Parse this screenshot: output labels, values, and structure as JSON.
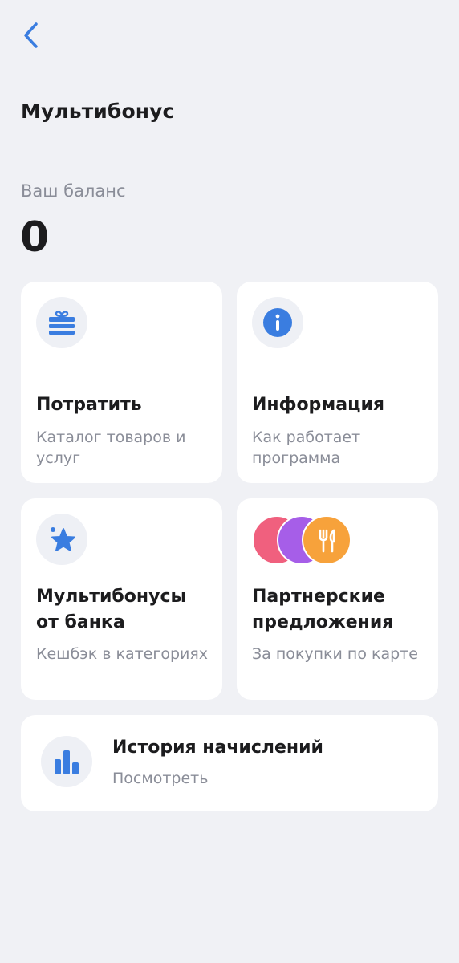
{
  "header": {
    "title": "Мультибонус"
  },
  "balance": {
    "label": "Ваш баланс",
    "value": "0"
  },
  "tiles": {
    "spend": {
      "title": "Потратить",
      "subtitle": "Каталог товаров и услуг",
      "icon": "gift-icon"
    },
    "info": {
      "title": "Информация",
      "subtitle": "Как работает программа",
      "icon": "info-icon"
    },
    "bank_bonuses": {
      "title": "Мультибонусы от банка",
      "subtitle": "Кешбэк в категориях",
      "icon": "star-icon"
    },
    "partners": {
      "title": "Партнерские предложения",
      "subtitle": "За покупки по карте",
      "icon": "fork-knife-icon"
    }
  },
  "history": {
    "title": "История начислений",
    "subtitle": "Посмотреть",
    "icon": "bar-chart-icon"
  },
  "colors": {
    "accent": "#3a7de0",
    "background": "#f0f1f5",
    "partner_pink": "#f0607e",
    "partner_purple": "#a65ee8",
    "partner_orange": "#f7a23b"
  }
}
